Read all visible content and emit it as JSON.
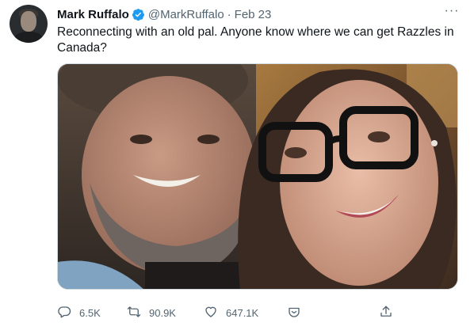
{
  "tweet": {
    "author": {
      "name": "Mark Ruffalo",
      "handle": "@MarkRuffalo",
      "separator": "·",
      "date": "Feb 23",
      "verified": true
    },
    "text": "Reconnecting with an old pal. Anyone know where we can get Razzles in Canada?",
    "actions": {
      "reply_count": "6.5K",
      "retweet_count": "90.9K",
      "like_count": "647.1K"
    }
  },
  "icons": {
    "verified": "verified-badge-icon",
    "more": "more-icon",
    "reply": "reply-icon",
    "retweet": "retweet-icon",
    "like": "like-icon",
    "tip": "tip-icon",
    "share": "share-icon"
  },
  "colors": {
    "verified_blue": "#1d9bf0",
    "muted_text": "#536471",
    "primary_text": "#0f1419"
  }
}
